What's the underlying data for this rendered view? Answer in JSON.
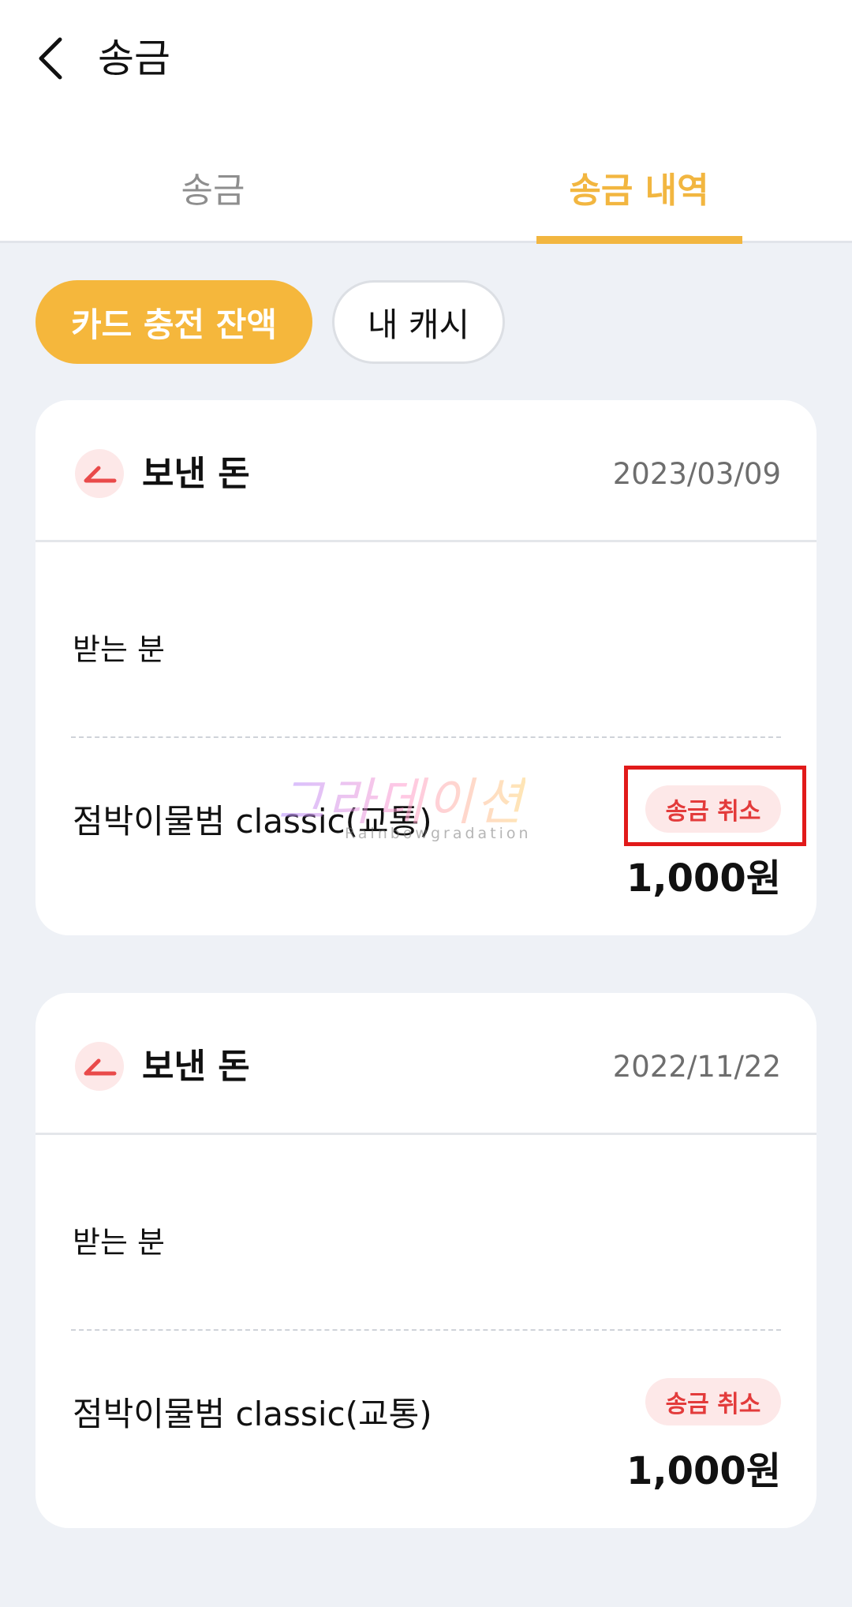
{
  "header": {
    "title": "송금",
    "back_icon": "chevron-left-icon"
  },
  "tabs": [
    {
      "label": "송금",
      "active": false
    },
    {
      "label": "송금 내역",
      "active": true
    }
  ],
  "filters": [
    {
      "label": "카드 충전 잔액",
      "selected": true
    },
    {
      "label": "내 캐시",
      "selected": false
    }
  ],
  "colors": {
    "accent": "#f2b640",
    "cancel_text": "#e33b3b",
    "cancel_bg": "#fde8e8",
    "highlight": "#e11a1a"
  },
  "transactions": [
    {
      "type_label": "보낸 돈",
      "icon": "sent-arrow-icon",
      "date": "2023/03/09",
      "recipient_label": "받는 분",
      "item": "점박이물범 classic(교통)",
      "action": "송금 취소",
      "amount": "1,000원"
    },
    {
      "type_label": "보낸 돈",
      "icon": "sent-arrow-icon",
      "date": "2022/11/22",
      "recipient_label": "받는 분",
      "item": "점박이물범 classic(교통)",
      "action": "송금 취소",
      "amount": "1,000원"
    }
  ],
  "watermark": {
    "text": "그라데이션",
    "subtext": "Rainbowgradation"
  }
}
